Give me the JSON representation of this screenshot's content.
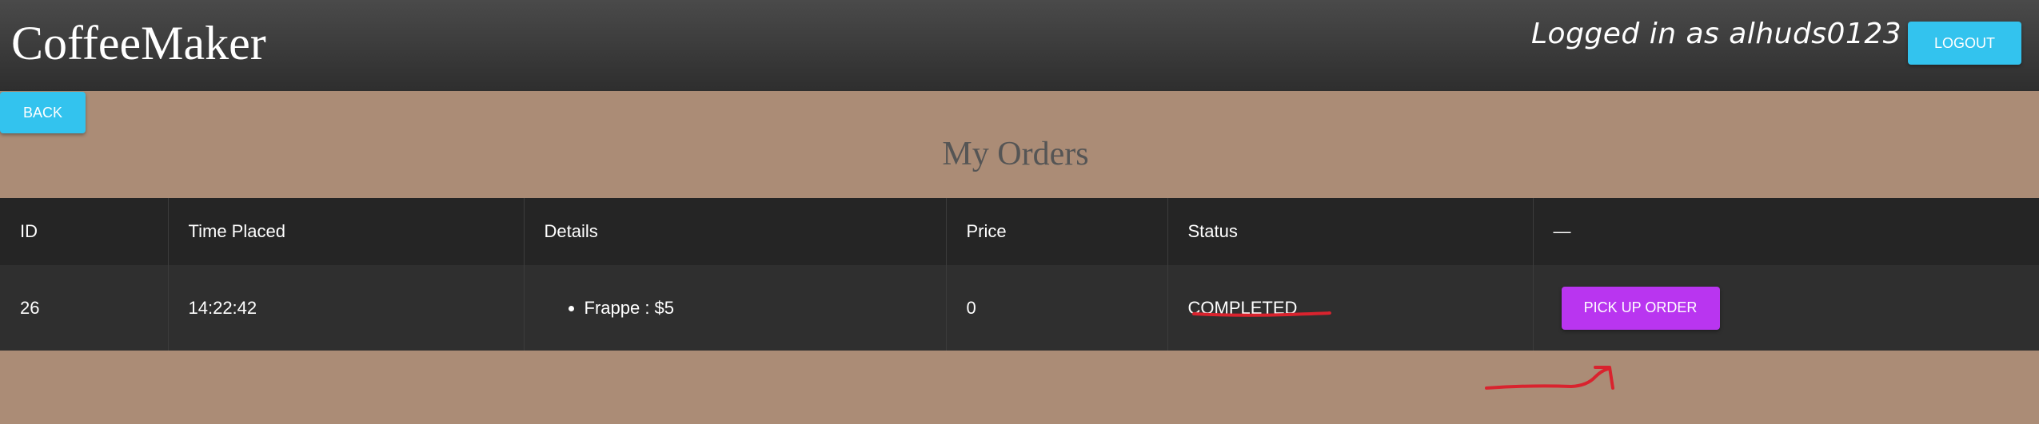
{
  "header": {
    "brand": "CoffeeMaker",
    "logged_in_text": "Logged in as alhuds0123",
    "logout_label": "LOGOUT"
  },
  "nav": {
    "back_label": "BACK"
  },
  "page": {
    "title": "My Orders"
  },
  "table": {
    "columns": [
      "ID",
      "Time Placed",
      "Details",
      "Price",
      "Status",
      "—"
    ],
    "rows": [
      {
        "id": "26",
        "time_placed": "14:22:42",
        "details": [
          "Frappe : $5"
        ],
        "price": "0",
        "status": "COMPLETED",
        "action_label": "PICK UP ORDER"
      }
    ]
  },
  "colors": {
    "background": "#ab8c76",
    "header": "#333333",
    "primary_button": "#33c3ee",
    "action_button": "#b935f0",
    "annotation": "#d9232e"
  }
}
